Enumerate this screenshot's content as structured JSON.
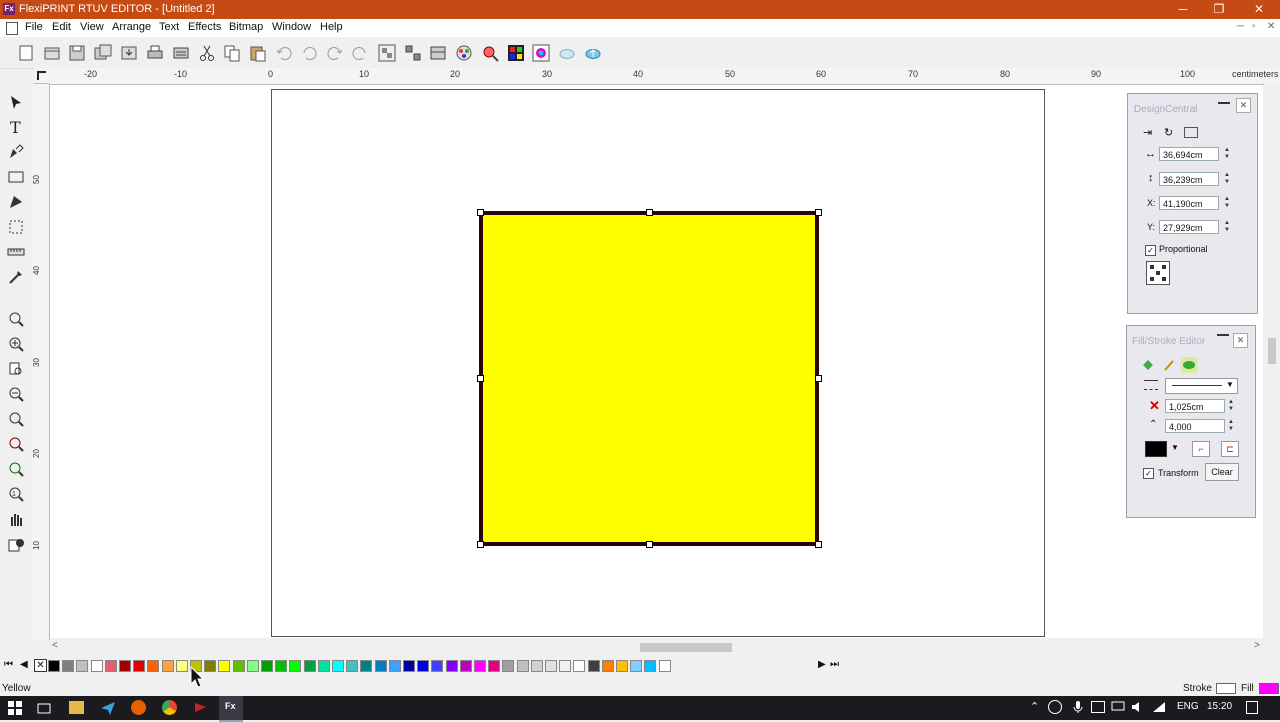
{
  "window": {
    "app_icon_text": "Fx",
    "title": "FlexiPRINT RTUV EDITOR - [Untitled 2]",
    "minimize": "─",
    "maximize": "❐",
    "close": "✕"
  },
  "menu": {
    "items": [
      "File",
      "Edit",
      "View",
      "Arrange",
      "Text",
      "Effects",
      "Bitmap",
      "Window",
      "Help"
    ],
    "mdi_minimize": "─",
    "mdi_restore": "▫",
    "mdi_close": "✕"
  },
  "ruler": {
    "h_labels": [
      "-20",
      "-10",
      "0",
      "10",
      "20",
      "30",
      "40",
      "50",
      "60",
      "70",
      "80",
      "90",
      "100"
    ],
    "unit": "centimeters",
    "v_labels": [
      "50",
      "40",
      "30",
      "20",
      "10"
    ]
  },
  "design_central": {
    "title": "DesignCentral",
    "width_value": "36,694cm",
    "height_value": "36,239cm",
    "x_label": "X:",
    "x_value": "41,190cm",
    "y_label": "Y:",
    "y_value": "27,929cm",
    "proportional_label": "Proportional",
    "proportional_checked": "✓"
  },
  "fill_stroke": {
    "title": "Fill/Stroke Editor",
    "stroke_width": "1,025cm",
    "miter": "4,000",
    "transform_label": "Transform",
    "transform_checked": "✓",
    "clear_label": "Clear",
    "stroke_color": "#000000"
  },
  "shape": {
    "fill_color": "#ffff00",
    "stroke_color": "#2a0606"
  },
  "palette": {
    "colors": [
      "#000000",
      "#7f7f7f",
      "#bfbfbf",
      "#ffffff",
      "#e06070",
      "#a00000",
      "#e00000",
      "#ff6000",
      "#ffa040",
      "#ffff80",
      "#c0c000",
      "#808000",
      "#ffff00",
      "#60c000",
      "#80ff80",
      "#00a000",
      "#00c000",
      "#00ff00",
      "#00a040",
      "#00e0a0",
      "#00ffff",
      "#40c0c0",
      "#008080",
      "#0080c0",
      "#40a0ff",
      "#0000a0",
      "#0000e0",
      "#4040ff",
      "#8000ff",
      "#c000c0",
      "#ff00ff",
      "#e00080",
      "#a0a0a0",
      "#c0c0c0",
      "#d0d0d0",
      "#e0e0e0",
      "#f0f0f0",
      "#ffffff",
      "#404040",
      "#ff8000",
      "#ffc000",
      "#80d0ff",
      "#00c0ff",
      "#ffffff"
    ]
  },
  "status": {
    "left_text": "Yellow",
    "stroke_label": "Stroke",
    "fill_label": "Fill",
    "fill_color": "#ff00ff"
  },
  "taskbar": {
    "lang": "ENG",
    "time": "15:20",
    "fx_label": "Fx"
  }
}
